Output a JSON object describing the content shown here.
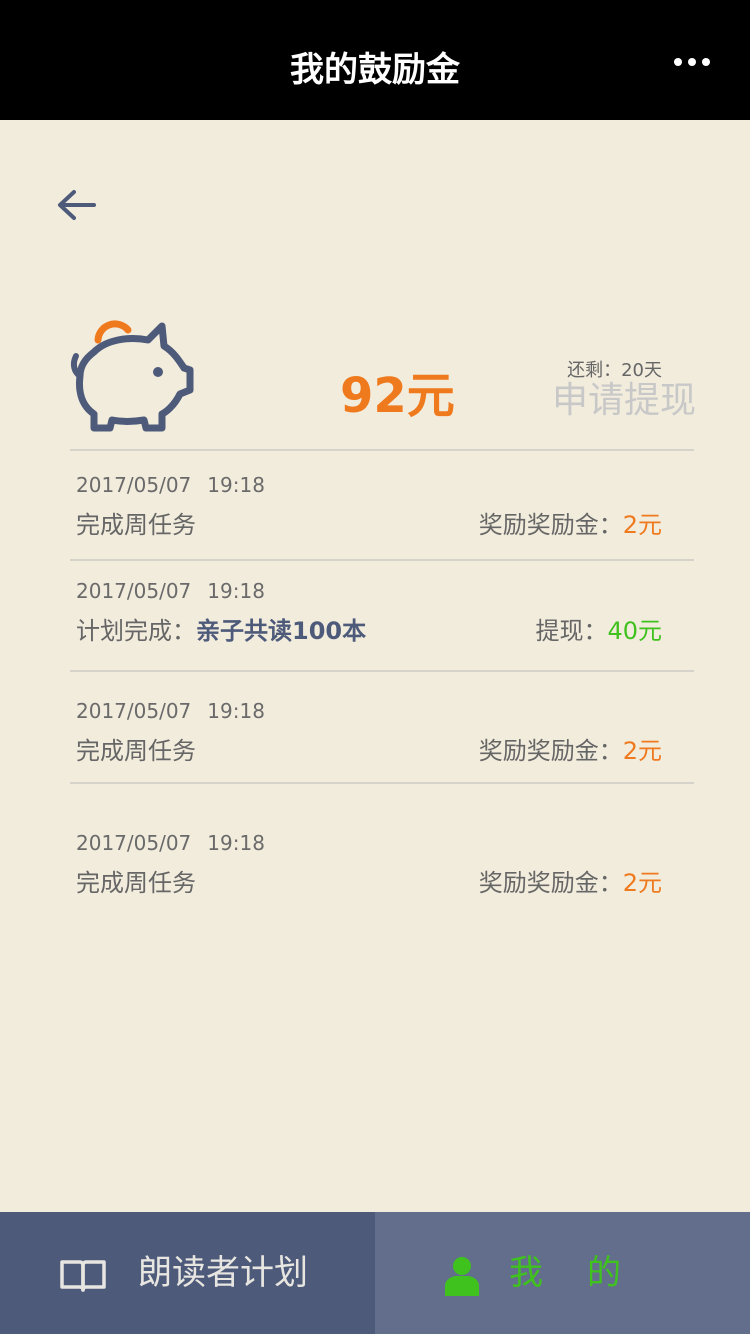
{
  "header": {
    "title": "我的鼓励金"
  },
  "summary": {
    "amount": "92元",
    "remaining_label": "还剩：20天",
    "withdraw_label": "申请提现"
  },
  "records": [
    {
      "date": "2017/05/07",
      "time": "19:18",
      "desc": "完成周任务",
      "amount_label": "奖励奖励金：",
      "amount_value": "2元"
    },
    {
      "date": "2017/05/07",
      "time": "19:18",
      "desc": "计划完成：",
      "desc_bold": "亲子共读100本",
      "amount_label": "提现：",
      "amount_value": "40元"
    },
    {
      "date": "2017/05/07",
      "time": "19:18",
      "desc": "完成周任务",
      "amount_label": "奖励奖励金：",
      "amount_value": "2元"
    },
    {
      "date": "2017/05/07",
      "time": "19:18",
      "desc": "完成周任务",
      "amount_label": "奖励奖励金：",
      "amount_value": "2元"
    }
  ],
  "tabbar": {
    "tabs": [
      {
        "label": "朗读者计划",
        "icon": "book-icon"
      },
      {
        "label": "我的",
        "icon": "user-icon"
      }
    ]
  },
  "colors": {
    "accent_orange": "#ef7a1e",
    "accent_green": "#3fc21e",
    "nav_blue": "#4e5a7a",
    "background": "#f2ecdd"
  }
}
